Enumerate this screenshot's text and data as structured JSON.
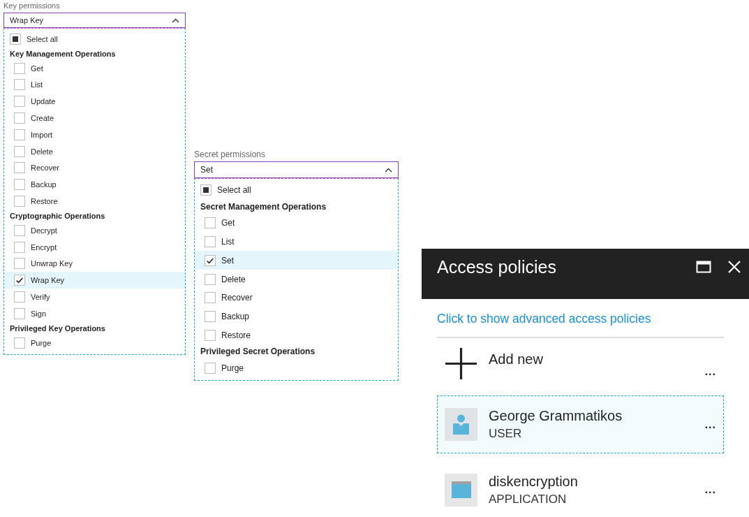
{
  "key_permissions": {
    "label": "Key permissions",
    "value": "Wrap Key",
    "expanded": true,
    "select_all": {
      "label": "Select all",
      "indeterminate": true
    },
    "groups": [
      {
        "title": "Key Management Operations",
        "items": [
          {
            "label": "Get",
            "checked": false,
            "selected": false
          },
          {
            "label": "List",
            "checked": false,
            "selected": false
          },
          {
            "label": "Update",
            "checked": false,
            "selected": false
          },
          {
            "label": "Create",
            "checked": false,
            "selected": false
          },
          {
            "label": "Import",
            "checked": false,
            "selected": false
          },
          {
            "label": "Delete",
            "checked": false,
            "selected": false
          },
          {
            "label": "Recover",
            "checked": false,
            "selected": false
          },
          {
            "label": "Backup",
            "checked": false,
            "selected": false
          },
          {
            "label": "Restore",
            "checked": false,
            "selected": false
          }
        ]
      },
      {
        "title": "Cryptographic Operations",
        "items": [
          {
            "label": "Decrypt",
            "checked": false,
            "selected": false
          },
          {
            "label": "Encrypt",
            "checked": false,
            "selected": false
          },
          {
            "label": "Unwrap Key",
            "checked": false,
            "selected": false
          },
          {
            "label": "Wrap Key",
            "checked": true,
            "selected": true
          },
          {
            "label": "Verify",
            "checked": false,
            "selected": false
          },
          {
            "label": "Sign",
            "checked": false,
            "selected": false
          }
        ]
      },
      {
        "title": "Privileged Key Operations",
        "items": [
          {
            "label": "Purge",
            "checked": false,
            "selected": false
          }
        ]
      }
    ]
  },
  "secret_permissions": {
    "label": "Secret permissions",
    "value": "Set",
    "expanded": true,
    "select_all": {
      "label": "Select all",
      "indeterminate": true
    },
    "groups": [
      {
        "title": "Secret Management Operations",
        "items": [
          {
            "label": "Get",
            "checked": false,
            "selected": false
          },
          {
            "label": "List",
            "checked": false,
            "selected": false
          },
          {
            "label": "Set",
            "checked": true,
            "selected": true
          },
          {
            "label": "Delete",
            "checked": false,
            "selected": false
          },
          {
            "label": "Recover",
            "checked": false,
            "selected": false
          },
          {
            "label": "Backup",
            "checked": false,
            "selected": false
          },
          {
            "label": "Restore",
            "checked": false,
            "selected": false
          }
        ]
      },
      {
        "title": "Privileged Secret Operations",
        "items": [
          {
            "label": "Purge",
            "checked": false,
            "selected": false
          }
        ]
      }
    ]
  },
  "access_policies": {
    "title": "Access policies",
    "link": "Click to show advanced access policies",
    "entries": [
      {
        "kind": "add",
        "name": "Add new",
        "more": "...",
        "selected": false
      },
      {
        "kind": "user",
        "name": "George Grammatikos",
        "type": "USER",
        "more": "...",
        "selected": true
      },
      {
        "kind": "application",
        "name": "diskencryption",
        "type": "APPLICATION",
        "more": "...",
        "selected": false
      }
    ]
  }
}
